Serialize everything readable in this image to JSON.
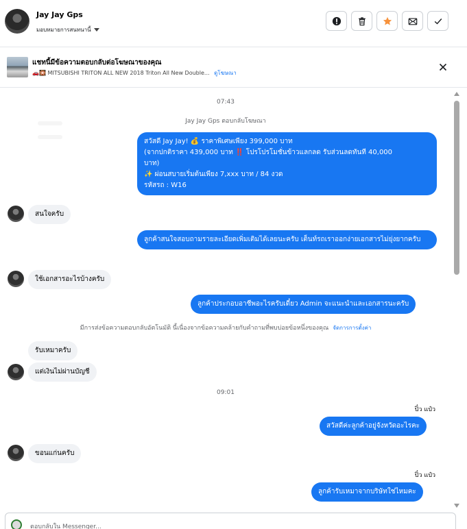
{
  "header": {
    "name": "Jay Jay Gps",
    "subtitle": "มอบหมายการสนทนานี้",
    "actions": [
      {
        "name": "report",
        "icon": "exclamation-icon"
      },
      {
        "name": "delete",
        "icon": "trash-icon"
      },
      {
        "name": "star",
        "icon": "star-icon"
      },
      {
        "name": "mark-unread",
        "icon": "envelope-icon"
      },
      {
        "name": "done",
        "icon": "check-icon"
      }
    ]
  },
  "ad": {
    "title": "แชทนี้มีข้อความตอบกลับต่อโฆษณาของคุณ",
    "description": "🚗🎇 MITSUBISHI TRITON ALL NEW 2018 Triton All New Double...",
    "link": "ดูโฆษณา"
  },
  "conversation": {
    "time1": "07:43",
    "ad_reply_note": "Jay Jay Gps ตอบกลับโฆษณา",
    "msg1": {
      "line1": "สวัสดี Jay Jay! 💰 ราคาพิเศษเพียง 399,000 บาท",
      "line2": "(จากปกติราคา 439,000 บาท ‼️ โปรโปรโมชั่นข้าวแลกลด รับส่วนลดทันที 40,000",
      "line3": "บาท)",
      "line4": "✨ ผ่อนสบายเริ่มต้นเพียง 7,xxx บาท / 84 งวด",
      "line5": "รหัสรถ : W16"
    },
    "in1": "สนใจครับ",
    "msg2": "ลูกค้าสนใจสอบถามรายละเอียดเพิ่มเติมได้เลยนะครับ เต็นท์รถเราออกง่ายเอกสารไม่ยุ่งยากครับ",
    "in2": "ใช้เอกสารอะไรบ้างครับ",
    "msg3": "ลูกค้าประกอบอาชีพอะไรครับเดี๋ยว Admin จะแนะนำและเอกสารนะครับ",
    "auto_note": "มีการส่งข้อความตอบกลับอัตโนมัติ นี้เนื่องจากข้อความคล้ายกับคำถามที่พบบ่อยข้อหนึ่งของคุณ",
    "auto_note_link": "จัดการการตั้งค่า",
    "in3": "รับเหมาครับ",
    "in4": "แต่เงินไม่ผ่านบัญชี",
    "time2": "09:01",
    "sender1": "ปิ๋ว แป๋ว",
    "msg4": "สวัสดีค่ะลูกค้าอยู่จังหวัดอะไรคะ",
    "in5": "ขอนแก่นครับ",
    "sender2": "ปิ๋ว แป๋ว",
    "msg5": "ลูกค้ารับเหมาจากบริษัทใช่ไหมคะ"
  },
  "composer": {
    "placeholder": "ตอบกลับใน Messenger..."
  }
}
